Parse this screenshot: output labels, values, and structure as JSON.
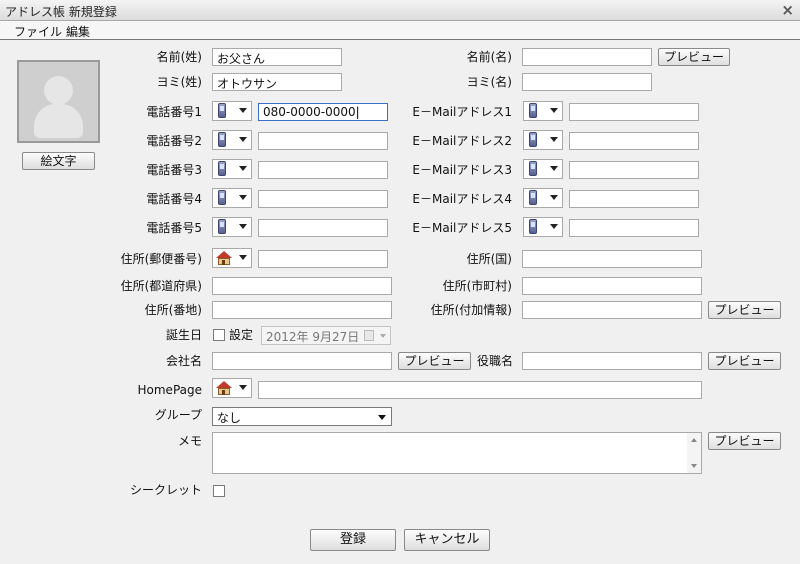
{
  "window": {
    "title": "アドレス帳  新規登録",
    "close_icon": "close-icon"
  },
  "menu": {
    "items": [
      "ファイル",
      "編集"
    ]
  },
  "avatar": {
    "emoji_button": "絵文字"
  },
  "form": {
    "name_sei": {
      "label": "名前(姓)",
      "value": "お父さん"
    },
    "yomi_sei": {
      "label": "ヨミ(姓)",
      "value": "オトウサン"
    },
    "name_mei": {
      "label": "名前(名)",
      "value": ""
    },
    "yomi_mei": {
      "label": "ヨミ(名)",
      "value": ""
    },
    "preview": "プレビュー",
    "phones": [
      {
        "label": "電話番号1",
        "value": "080-0000-0000"
      },
      {
        "label": "電話番号2",
        "value": ""
      },
      {
        "label": "電話番号3",
        "value": ""
      },
      {
        "label": "電話番号4",
        "value": ""
      },
      {
        "label": "電話番号5",
        "value": ""
      }
    ],
    "emails": [
      {
        "label": "E－Mailアドレス1",
        "value": ""
      },
      {
        "label": "E－Mailアドレス2",
        "value": ""
      },
      {
        "label": "E－Mailアドレス3",
        "value": ""
      },
      {
        "label": "E－Mailアドレス4",
        "value": ""
      },
      {
        "label": "E－Mailアドレス5",
        "value": ""
      }
    ],
    "postal": {
      "label": "住所(郵便番号)",
      "value": ""
    },
    "country": {
      "label": "住所(国)",
      "value": ""
    },
    "prefecture": {
      "label": "住所(都道府県)",
      "value": ""
    },
    "city": {
      "label": "住所(市町村)",
      "value": ""
    },
    "street": {
      "label": "住所(番地)",
      "value": ""
    },
    "extra": {
      "label": "住所(付加情報)",
      "value": ""
    },
    "birthday": {
      "label": "誕生日",
      "checkbox_label": "設定",
      "date": "2012年  9月27日"
    },
    "company": {
      "label": "会社名",
      "value": ""
    },
    "position": {
      "label": "役職名",
      "value": ""
    },
    "homepage": {
      "label": "HomePage",
      "value": ""
    },
    "group": {
      "label": "グループ",
      "selected": "なし"
    },
    "memo": {
      "label": "メモ",
      "value": ""
    },
    "secret": {
      "label": "シークレット"
    }
  },
  "actions": {
    "register": "登録",
    "cancel": "キャンセル"
  }
}
